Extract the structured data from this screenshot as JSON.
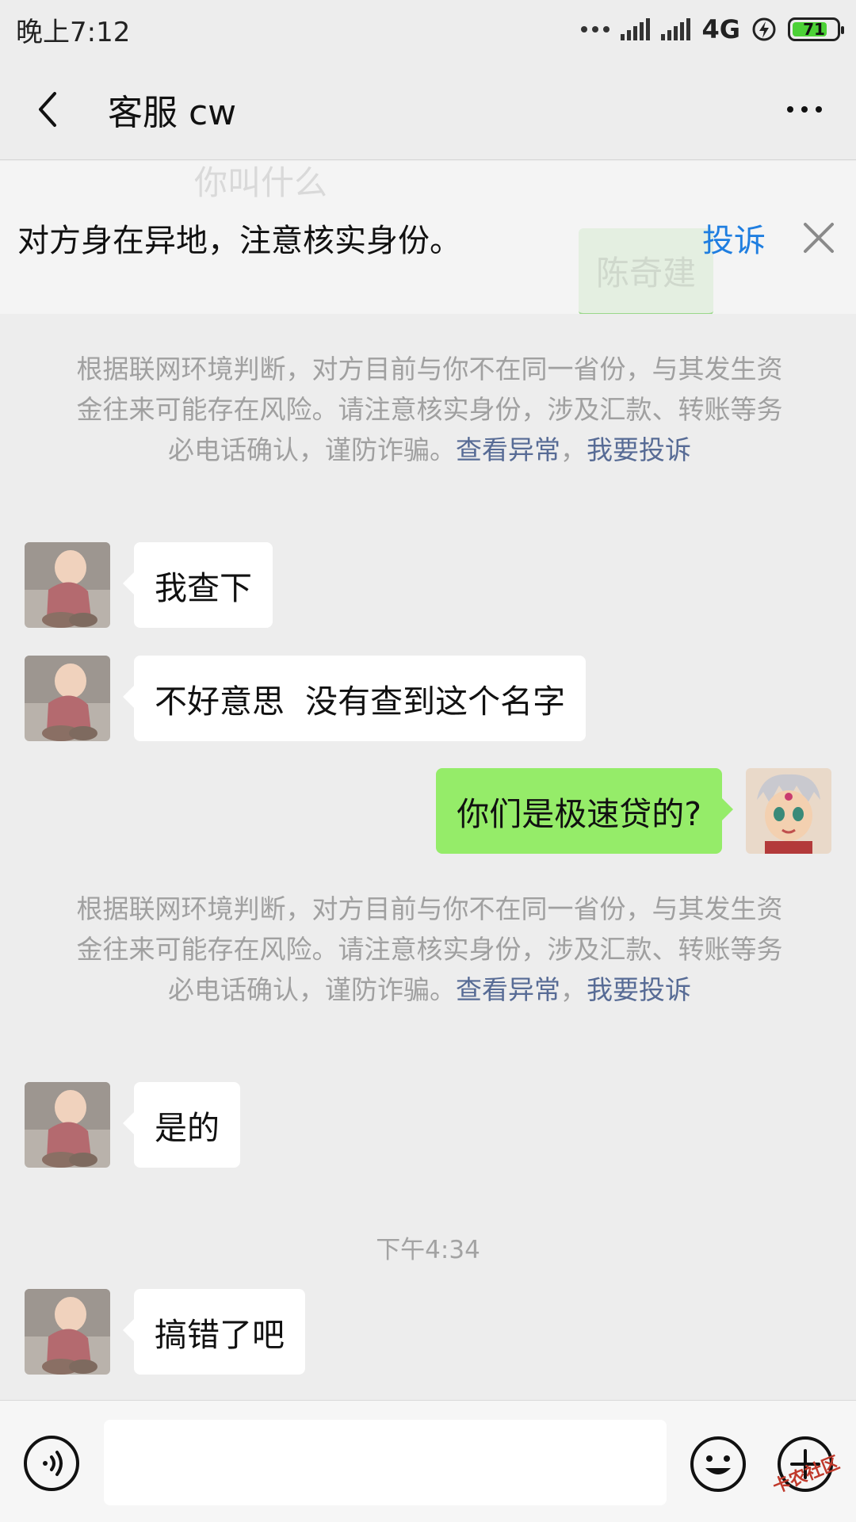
{
  "status_bar": {
    "time": "晚上7:12",
    "network": "4G",
    "battery": "71"
  },
  "nav": {
    "title": "客服 cw"
  },
  "banner": {
    "text": "对方身在异地，注意核实身份。",
    "complain": "投诉",
    "ghost_text": "你叫什么",
    "ghost_bubble": "陈奇建"
  },
  "notice1": {
    "text": "根据联网环境判断，对方目前与你不在同一省份，与其发生资金往来可能存在风险。请注意核实身份，涉及汇款、转账等务必电话确认，谨防诈骗。",
    "link1": "查看异常",
    "sep": "，",
    "link2": "我要投诉"
  },
  "notice2": {
    "text": "根据联网环境判断，对方目前与你不在同一省份，与其发生资金往来可能存在风险。请注意核实身份，涉及汇款、转账等务必电话确认，谨防诈骗。",
    "link1": "查看异常",
    "sep": "，",
    "link2": "我要投诉"
  },
  "messages": [
    {
      "side": "left",
      "text": "我查下"
    },
    {
      "side": "left",
      "text": "不好意思  没有查到这个名字"
    },
    {
      "side": "right",
      "text": "你们是极速贷的?"
    },
    {
      "side": "left",
      "text": "是的"
    },
    {
      "side": "left",
      "text": "搞错了吧"
    }
  ],
  "time_label": "下午4:34",
  "input": {
    "value": ""
  },
  "watermark": "卡农社区",
  "colors": {
    "self_bubble": "#95ec69",
    "link": "#576b95",
    "complain": "#1f7ee0"
  }
}
